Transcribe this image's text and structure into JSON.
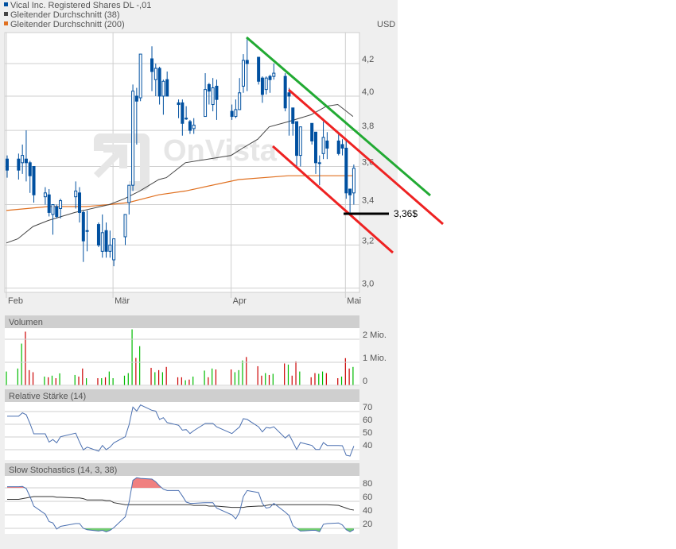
{
  "legend": [
    {
      "label": "Vical Inc. Registered Shares DL -,01",
      "color": "#0050a0"
    },
    {
      "label": "Gleitender Durchschnitt (38)",
      "color": "#444444"
    },
    {
      "label": "Gleitender Durchschnitt (200)",
      "color": "#e07020"
    }
  ],
  "currency": "USD",
  "watermark": "OnVista",
  "annotation_label": "3,36$",
  "colors": {
    "candle": "#0050a0",
    "ma38": "#444444",
    "ma200": "#e07020",
    "vol_up": "#00bb00",
    "vol_down": "#cc0000",
    "trend_green": "#22aa33",
    "trend_red": "#ee2222",
    "indicator": "#4a6fb0",
    "stoch_signal": "#333333",
    "overbought_fill": "#f08080",
    "oversold_fill": "#70cc70"
  },
  "chart_data": [
    {
      "type": "candlestick",
      "scale": "log",
      "ylim": [
        3.0,
        4.3
      ],
      "yticks": [
        "4,2",
        "4,0",
        "3,8",
        "3,6",
        "3,4",
        "3,2",
        "3,0"
      ],
      "ytick_values": [
        4.2,
        4.0,
        3.8,
        3.6,
        3.4,
        3.2,
        3.0
      ],
      "xticks": [
        {
          "label": "Feb",
          "date": "02-01"
        },
        {
          "label": "Mär",
          "date": "03-01"
        },
        {
          "label": "Apr",
          "date": "04-01"
        },
        {
          "label": "Mai",
          "date": "05-01"
        }
      ],
      "grid": true,
      "candles": [
        {
          "date": "02-01",
          "o": 3.64,
          "h": 3.66,
          "l": 3.54,
          "c": 3.58,
          "volume": 0.6,
          "vol_up": true
        },
        {
          "date": "02-04",
          "o": 3.64,
          "h": 3.67,
          "l": 3.53,
          "c": 3.58,
          "volume": 0.73,
          "vol_up": true
        },
        {
          "date": "02-05",
          "o": 3.62,
          "h": 3.72,
          "l": 3.56,
          "c": 3.66,
          "volume": 1.81,
          "vol_up": true
        },
        {
          "date": "02-06",
          "o": 3.64,
          "h": 3.8,
          "l": 3.52,
          "c": 3.62,
          "volume": 2.33,
          "vol_up": false
        },
        {
          "date": "02-07",
          "o": 3.62,
          "h": 3.63,
          "l": 3.46,
          "c": 3.55,
          "volume": 0.66,
          "vol_up": false
        },
        {
          "date": "02-08",
          "o": 3.6,
          "h": 3.6,
          "l": 3.41,
          "c": 3.45,
          "volume": 0.57,
          "vol_up": false
        },
        {
          "date": "02-11",
          "o": 3.44,
          "h": 3.49,
          "l": 3.4,
          "c": 3.46,
          "volume": 0.38,
          "vol_up": true
        },
        {
          "date": "02-12",
          "o": 3.45,
          "h": 3.48,
          "l": 3.34,
          "c": 3.36,
          "volume": 0.35,
          "vol_up": false
        },
        {
          "date": "02-13",
          "o": 3.35,
          "h": 3.4,
          "l": 3.25,
          "c": 3.4,
          "volume": 0.42,
          "vol_up": true
        },
        {
          "date": "02-14",
          "o": 3.39,
          "h": 3.4,
          "l": 3.33,
          "c": 3.34,
          "volume": 0.31,
          "vol_up": false
        },
        {
          "date": "02-15",
          "o": 3.38,
          "h": 3.43,
          "l": 3.33,
          "c": 3.42,
          "volume": 0.52,
          "vol_up": true
        },
        {
          "date": "02-19",
          "o": 3.44,
          "h": 3.52,
          "l": 3.38,
          "c": 3.47,
          "volume": 0.45,
          "vol_up": true
        },
        {
          "date": "02-20",
          "o": 3.46,
          "h": 3.49,
          "l": 3.31,
          "c": 3.36,
          "volume": 0.38,
          "vol_up": false
        },
        {
          "date": "02-21",
          "o": 3.36,
          "h": 3.37,
          "l": 3.12,
          "c": 3.22,
          "volume": 0.73,
          "vol_up": false
        },
        {
          "date": "02-22",
          "o": 3.27,
          "h": 3.37,
          "l": 3.17,
          "c": 3.27,
          "volume": 0.31,
          "vol_up": true
        },
        {
          "date": "02-25",
          "o": 3.3,
          "h": 3.31,
          "l": 3.19,
          "c": 3.2,
          "volume": 0.31,
          "vol_up": false
        },
        {
          "date": "02-26",
          "o": 3.17,
          "h": 3.35,
          "l": 3.14,
          "c": 3.26,
          "volume": 0.31,
          "vol_up": true
        },
        {
          "date": "02-27",
          "o": 3.27,
          "h": 3.31,
          "l": 3.14,
          "c": 3.17,
          "volume": 0.35,
          "vol_up": false
        },
        {
          "date": "02-28",
          "o": 3.17,
          "h": 3.27,
          "l": 3.14,
          "c": 3.2,
          "volume": 0.6,
          "vol_up": true
        },
        {
          "date": "03-01",
          "o": 3.13,
          "h": 3.23,
          "l": 3.1,
          "c": 3.23,
          "volume": 0.31,
          "vol_up": true
        },
        {
          "date": "03-04",
          "o": 3.24,
          "h": 3.35,
          "l": 3.2,
          "c": 3.35,
          "volume": 0.42,
          "vol_up": true
        },
        {
          "date": "03-05",
          "o": 3.41,
          "h": 3.5,
          "l": 3.35,
          "c": 3.5,
          "volume": 0.53,
          "vol_up": true
        },
        {
          "date": "03-06",
          "o": 3.5,
          "h": 4.07,
          "l": 3.47,
          "c": 4.03,
          "volume": 2.43,
          "vol_up": true
        },
        {
          "date": "03-07",
          "o": 4.0,
          "h": 4.05,
          "l": 3.72,
          "c": 3.97,
          "volume": 1.19,
          "vol_up": false
        },
        {
          "date": "03-08",
          "o": 3.99,
          "h": 4.26,
          "l": 3.97,
          "c": 4.26,
          "volume": 1.7,
          "vol_up": true
        },
        {
          "date": "03-11",
          "o": 4.23,
          "h": 4.31,
          "l": 4.03,
          "c": 4.15,
          "volume": 0.76,
          "vol_up": false
        },
        {
          "date": "03-12",
          "o": 4.1,
          "h": 4.2,
          "l": 4.0,
          "c": 4.17,
          "volume": 0.57,
          "vol_up": true
        },
        {
          "date": "03-13",
          "o": 4.17,
          "h": 4.18,
          "l": 3.95,
          "c": 4.0,
          "volume": 0.66,
          "vol_up": false
        },
        {
          "date": "03-14",
          "o": 4.0,
          "h": 4.1,
          "l": 3.89,
          "c": 4.09,
          "volume": 0.57,
          "vol_up": true
        },
        {
          "date": "03-15",
          "o": 4.1,
          "h": 4.15,
          "l": 4.0,
          "c": 4.0,
          "volume": 0.8,
          "vol_up": false
        },
        {
          "date": "03-18",
          "o": 3.96,
          "h": 3.98,
          "l": 3.87,
          "c": 3.95,
          "volume": 0.35,
          "vol_up": false
        },
        {
          "date": "03-19",
          "o": 3.96,
          "h": 3.98,
          "l": 3.77,
          "c": 3.84,
          "volume": 0.35,
          "vol_up": false
        },
        {
          "date": "03-20",
          "o": 3.87,
          "h": 3.94,
          "l": 3.86,
          "c": 3.87,
          "volume": 0.22,
          "vol_up": true
        },
        {
          "date": "03-21",
          "o": 3.85,
          "h": 3.86,
          "l": 3.78,
          "c": 3.8,
          "volume": 0.25,
          "vol_up": false
        },
        {
          "date": "03-22",
          "o": 3.81,
          "h": 3.87,
          "l": 3.78,
          "c": 3.83,
          "volume": 0.38,
          "vol_up": true
        },
        {
          "date": "03-25",
          "o": 3.88,
          "h": 4.14,
          "l": 3.88,
          "c": 4.04,
          "volume": 0.64,
          "vol_up": true
        },
        {
          "date": "03-26",
          "o": 4.07,
          "h": 4.08,
          "l": 3.95,
          "c": 4.03,
          "volume": 0.35,
          "vol_up": false
        },
        {
          "date": "03-27",
          "o": 3.95,
          "h": 4.11,
          "l": 3.91,
          "c": 4.05,
          "volume": 0.73,
          "vol_up": true
        },
        {
          "date": "03-28",
          "o": 4.06,
          "h": 4.1,
          "l": 3.86,
          "c": 3.98,
          "volume": 0.69,
          "vol_up": false
        },
        {
          "date": "04-01",
          "o": 3.91,
          "h": 3.95,
          "l": 3.86,
          "c": 3.88,
          "volume": 0.69,
          "vol_up": false
        },
        {
          "date": "04-02",
          "o": 3.88,
          "h": 3.98,
          "l": 3.87,
          "c": 3.92,
          "volume": 0.57,
          "vol_up": true
        },
        {
          "date": "04-03",
          "o": 3.92,
          "h": 4.11,
          "l": 3.92,
          "c": 4.02,
          "volume": 0.66,
          "vol_up": true
        },
        {
          "date": "04-04",
          "o": 4.06,
          "h": 4.26,
          "l": 4.02,
          "c": 4.22,
          "volume": 1.08,
          "vol_up": true
        },
        {
          "date": "04-05",
          "o": 4.22,
          "h": 4.36,
          "l": 4.03,
          "c": 4.2,
          "volume": 1.23,
          "vol_up": false
        },
        {
          "date": "04-08",
          "o": 4.24,
          "h": 4.24,
          "l": 4.07,
          "c": 4.09,
          "volume": 0.83,
          "vol_up": false
        },
        {
          "date": "04-09",
          "o": 4.11,
          "h": 4.12,
          "l": 3.96,
          "c": 4.01,
          "volume": 0.42,
          "vol_up": false
        },
        {
          "date": "04-10",
          "o": 4.04,
          "h": 4.12,
          "l": 4.01,
          "c": 4.11,
          "volume": 0.53,
          "vol_up": true
        },
        {
          "date": "04-11",
          "o": 4.12,
          "h": 4.13,
          "l": 4.02,
          "c": 4.1,
          "volume": 0.45,
          "vol_up": false
        },
        {
          "date": "04-12",
          "o": 4.12,
          "h": 4.2,
          "l": 4.1,
          "c": 4.14,
          "volume": 0.5,
          "vol_up": true
        },
        {
          "date": "04-15",
          "o": 4.12,
          "h": 4.14,
          "l": 3.91,
          "c": 3.93,
          "volume": 0.95,
          "vol_up": false
        },
        {
          "date": "04-16",
          "o": 4.02,
          "h": 4.05,
          "l": 3.77,
          "c": 4.0,
          "volume": 0.9,
          "vol_up": true
        },
        {
          "date": "04-17",
          "o": 3.93,
          "h": 3.93,
          "l": 3.77,
          "c": 3.84,
          "volume": 0.42,
          "vol_up": false
        },
        {
          "date": "04-18",
          "o": 3.85,
          "h": 3.85,
          "l": 3.6,
          "c": 3.66,
          "volume": 1.04,
          "vol_up": false
        },
        {
          "date": "04-19",
          "o": 3.66,
          "h": 3.82,
          "l": 3.6,
          "c": 3.82,
          "volume": 0.6,
          "vol_up": true
        },
        {
          "date": "04-22",
          "o": 3.84,
          "h": 3.84,
          "l": 3.72,
          "c": 3.74,
          "volume": 0.35,
          "vol_up": false
        },
        {
          "date": "04-23",
          "o": 3.79,
          "h": 3.79,
          "l": 3.56,
          "c": 3.62,
          "volume": 0.53,
          "vol_up": false
        },
        {
          "date": "04-24",
          "o": 3.62,
          "h": 3.66,
          "l": 3.5,
          "c": 3.62,
          "volume": 0.5,
          "vol_up": true
        },
        {
          "date": "04-25",
          "o": 3.67,
          "h": 3.85,
          "l": 3.64,
          "c": 3.76,
          "volume": 0.6,
          "vol_up": true
        },
        {
          "date": "04-26",
          "o": 3.74,
          "h": 3.79,
          "l": 3.64,
          "c": 3.7,
          "volume": 0.53,
          "vol_up": false
        },
        {
          "date": "04-29",
          "o": 3.74,
          "h": 3.78,
          "l": 3.66,
          "c": 3.67,
          "volume": 0.31,
          "vol_up": false
        },
        {
          "date": "04-30",
          "o": 3.72,
          "h": 3.75,
          "l": 3.66,
          "c": 3.7,
          "volume": 0.38,
          "vol_up": true
        },
        {
          "date": "05-01",
          "o": 3.7,
          "h": 3.75,
          "l": 3.43,
          "c": 3.46,
          "volume": 1.18,
          "vol_up": false
        },
        {
          "date": "05-02",
          "o": 3.48,
          "h": 3.48,
          "l": 3.36,
          "c": 3.45,
          "volume": 0.73,
          "vol_up": false
        },
        {
          "date": "05-03",
          "o": 3.46,
          "h": 3.61,
          "l": 3.4,
          "c": 3.59,
          "volume": 0.8,
          "vol_up": true
        }
      ],
      "ma38": [
        [
          "02-01",
          3.21
        ],
        [
          "02-04",
          3.23
        ],
        [
          "02-08",
          3.29
        ],
        [
          "02-12",
          3.32
        ],
        [
          "02-19",
          3.36
        ],
        [
          "02-28",
          3.4
        ],
        [
          "03-04",
          3.43
        ],
        [
          "03-08",
          3.47
        ],
        [
          "03-13",
          3.53
        ],
        [
          "03-15",
          3.54
        ],
        [
          "03-20",
          3.62
        ],
        [
          "04-01",
          3.66
        ],
        [
          "04-04",
          3.7
        ],
        [
          "04-08",
          3.75
        ],
        [
          "04-11",
          3.82
        ],
        [
          "04-16",
          3.85
        ],
        [
          "04-22",
          3.89
        ],
        [
          "04-26",
          3.94
        ],
        [
          "04-29",
          3.95
        ],
        [
          "05-03",
          3.88
        ]
      ],
      "ma200": [
        [
          "02-01",
          3.37
        ],
        [
          "02-12",
          3.39
        ],
        [
          "02-22",
          3.39
        ],
        [
          "02-28",
          3.4
        ],
        [
          "03-05",
          3.41
        ],
        [
          "03-13",
          3.45
        ],
        [
          "03-20",
          3.47
        ],
        [
          "04-03",
          3.53
        ],
        [
          "04-16",
          3.55
        ],
        [
          "05-03",
          3.55
        ]
      ]
    },
    {
      "type": "bar",
      "title": "Volumen",
      "yticks": [
        "2 Mio.",
        "1 Mio.",
        "0"
      ],
      "ytick_values": [
        2,
        1,
        0
      ],
      "unit": "Mio."
    },
    {
      "type": "line",
      "title": "Relative Stärke (14)",
      "yticks": [
        "70",
        "60",
        "50",
        "40"
      ],
      "ytick_values": [
        70,
        60,
        50,
        40
      ],
      "values": [
        66.3,
        66.3,
        69,
        67.5,
        60.6,
        52.5,
        52.5,
        46,
        48,
        45.4,
        50.2,
        53,
        46,
        39.8,
        42,
        38.8,
        43.3,
        40,
        42,
        45.4,
        50.2,
        59.6,
        73.5,
        70.4,
        75.2,
        71,
        70.4,
        63.8,
        65.2,
        61.3,
        59.2,
        55.4,
        55.8,
        52.7,
        55,
        60.6,
        60.6,
        60.6,
        58,
        52.7,
        55.4,
        57.9,
        64.4,
        63.8,
        58,
        54,
        57.5,
        57,
        58,
        49.2,
        51.9,
        46,
        40.2,
        45.6,
        43.3,
        40.2,
        40.2,
        45.6,
        43.3,
        43.3,
        43.1,
        35.6,
        35,
        42.9
      ]
    },
    {
      "type": "line",
      "title": "Slow Stochastics (14, 3, 38)",
      "yticks": [
        "80",
        "60",
        "40",
        "20"
      ],
      "ytick_values": [
        80,
        60,
        40,
        20
      ],
      "k": [
        81.6,
        81.6,
        82,
        79,
        67,
        53,
        41,
        30,
        28,
        19,
        23,
        27,
        27,
        20,
        18,
        16,
        17,
        15,
        17,
        21,
        37,
        59,
        91,
        95,
        94,
        93,
        89,
        83,
        78,
        76,
        76,
        68,
        59,
        57,
        57,
        58,
        58,
        58,
        50,
        40,
        34,
        44,
        67,
        76,
        73,
        57,
        50,
        51,
        57,
        44,
        39,
        24,
        20,
        16,
        17,
        17,
        15,
        26,
        27,
        28,
        25,
        18,
        15,
        18
      ],
      "d": [
        63,
        63,
        64,
        65,
        66,
        67,
        67,
        67,
        67,
        66,
        66,
        65,
        65,
        64,
        62,
        62,
        62,
        61,
        61,
        58,
        55,
        55,
        55,
        55,
        55,
        55,
        55,
        55,
        55,
        55,
        55,
        55,
        55,
        55,
        54,
        54,
        53,
        53,
        53,
        51,
        51,
        51,
        51,
        52,
        53,
        53,
        54,
        55,
        55,
        55,
        55,
        55,
        55,
        55,
        55,
        55,
        55,
        55,
        55,
        54,
        52,
        50,
        48,
        47
      ]
    }
  ]
}
